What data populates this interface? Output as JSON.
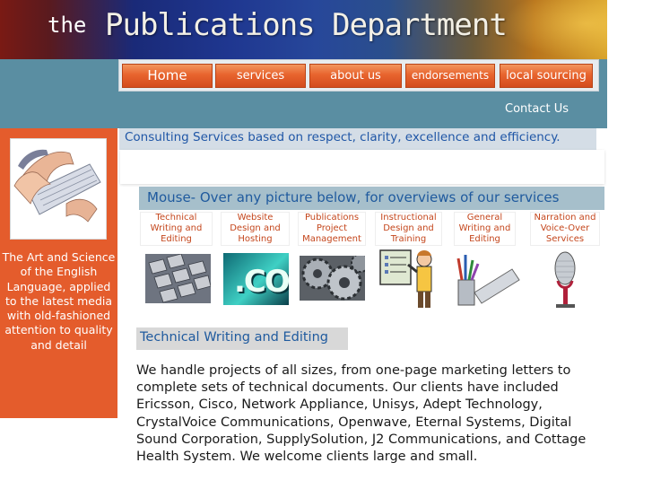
{
  "header": {
    "title_prefix": "the",
    "title": "Publications Department"
  },
  "nav": {
    "items": [
      {
        "label": "Home"
      },
      {
        "label": "services"
      },
      {
        "label": "about us"
      },
      {
        "label": "endorsements"
      },
      {
        "label": "local sourcing"
      }
    ],
    "contact": "Contact Us"
  },
  "sidebar": {
    "tagline": "The Art and Science of the English Language, applied to the latest media with old-fashioned attention to quality and detail"
  },
  "main": {
    "consulting": "Consulting Services based on respect, clarity, excellence and efficiency.",
    "mouseover": "Mouse- Over any picture below, for overviews of our services",
    "services": [
      {
        "label": "Technical Writing and Editing"
      },
      {
        "label": "Website Design and Hosting"
      },
      {
        "label": "Publications Project Management"
      },
      {
        "label": "Instructional Design and Training"
      },
      {
        "label": "General Writing and Editing"
      },
      {
        "label": "Narration and Voice-Over Services"
      }
    ],
    "website_image_text": ".COI",
    "section_title": "Technical Writing and Editing",
    "body": "We handle projects of all sizes, from one-page marketing letters to complete sets of technical documents. Our clients have included Ericsson, Cisco, Network Appliance, Unisys, Adept Technology, CrystalVoice Communications, Openwave, Eternal Systems, Digital Sound Corporation, SupplySolution, J2 Communications, and Cottage Health System. We welcome clients large and small."
  },
  "colors": {
    "orange": "#e45c2c",
    "teal": "#5a8ea2",
    "blue_text": "#1f5a9e",
    "label_orange": "#c4461c"
  }
}
